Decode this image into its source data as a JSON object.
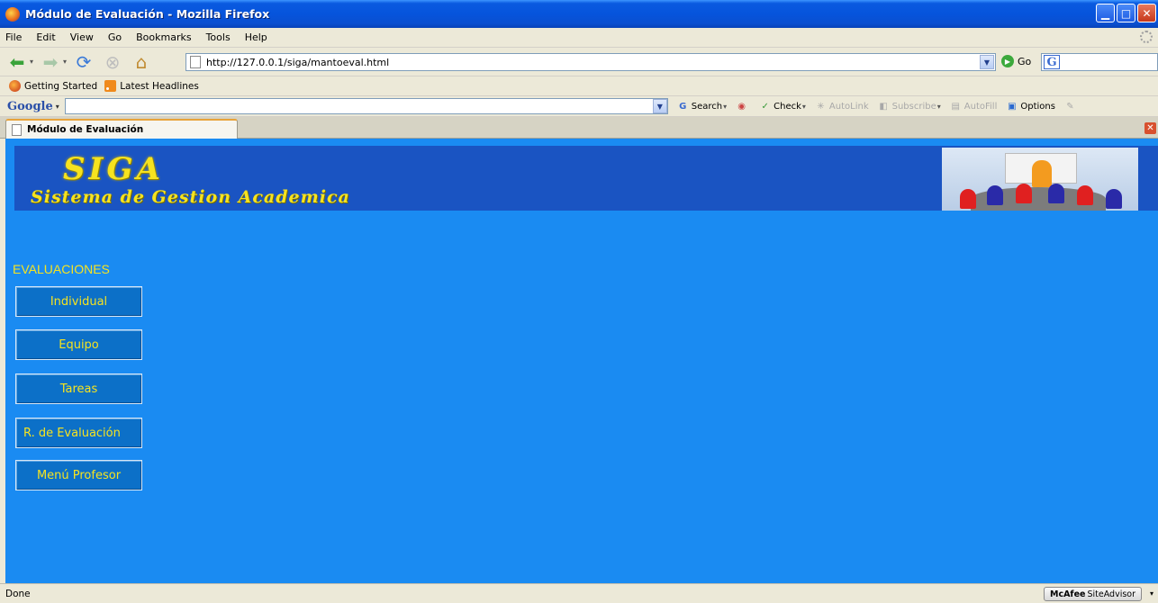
{
  "window": {
    "title": "Módulo de Evaluación - Mozilla Firefox"
  },
  "menubar": {
    "items": [
      "File",
      "Edit",
      "View",
      "Go",
      "Bookmarks",
      "Tools",
      "Help"
    ]
  },
  "navbar": {
    "url": "http://127.0.0.1/siga/mantoeval.html",
    "go_label": "Go"
  },
  "bookmarks": {
    "items": [
      "Getting Started",
      "Latest Headlines"
    ]
  },
  "google_toolbar": {
    "logo": "Google",
    "search_label": "Search",
    "check_label": "Check",
    "autolink_label": "AutoLink",
    "subscribe_label": "Subscribe",
    "autofill_label": "AutoFill",
    "options_label": "Options"
  },
  "tab": {
    "label": "Módulo de Evaluación"
  },
  "page": {
    "brand": "SIGA",
    "tagline": "Sistema de Gestion Academica",
    "section_title": "EVALUACIONES",
    "buttons": [
      "Individual",
      "Equipo",
      "Tareas",
      "R. de Evaluación",
      "Menú Profesor"
    ]
  },
  "statusbar": {
    "status": "Done",
    "addon_brand": "McAfee",
    "addon_name": "SiteAdvisor"
  },
  "colors": {
    "page_background": "#1a8bf2",
    "banner_background": "#1a54c2",
    "accent_text": "#f6e31f",
    "button_background": "#0c70c8"
  }
}
